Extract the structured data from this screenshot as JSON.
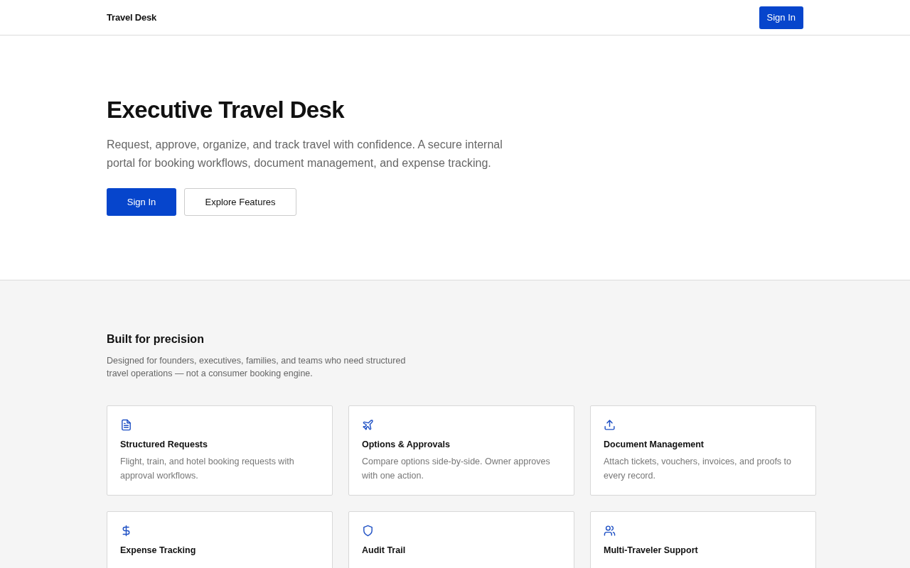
{
  "header": {
    "brand": "Travel Desk",
    "sign_in": "Sign In"
  },
  "hero": {
    "title": "Executive Travel Desk",
    "text": "Request, approve, organize, and track travel with confidence. A secure internal portal for booking workflows, document management, and expense tracking.",
    "primary": "Sign In",
    "secondary": "Explore Features"
  },
  "features": {
    "title": "Built for precision",
    "text": "Designed for founders, executives, families, and teams who need structured travel operations — not a consumer booking engine.",
    "cards": [
      {
        "title": "Structured Requests",
        "text": "Flight, train, and hotel booking requests with approval workflows."
      },
      {
        "title": "Options & Approvals",
        "text": "Compare options side-by-side. Owner approves with one action."
      },
      {
        "title": "Document Management",
        "text": "Attach tickets, vouchers, invoices, and proofs to every record."
      },
      {
        "title": "Expense Tracking"
      },
      {
        "title": "Audit Trail"
      },
      {
        "title": "Multi-Traveler Support"
      }
    ]
  }
}
